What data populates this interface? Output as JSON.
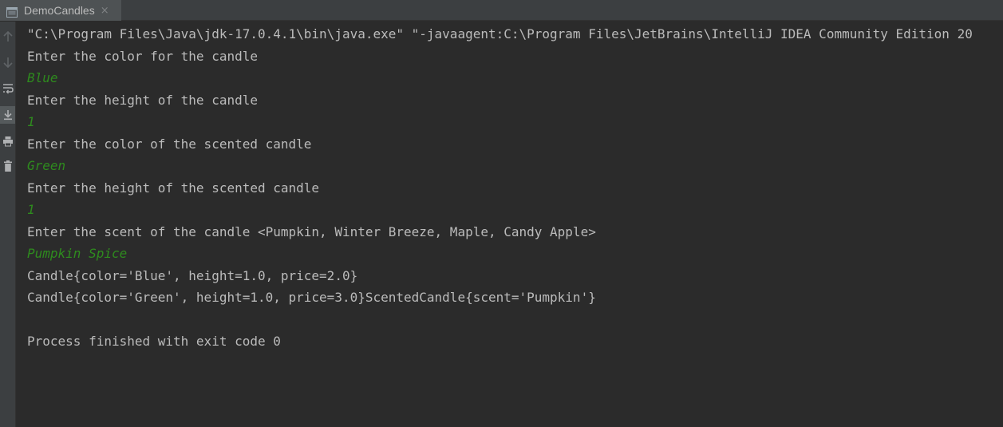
{
  "tab": {
    "title": "DemoCandles",
    "close_glyph": "×"
  },
  "toolbar": {
    "buttons": [
      {
        "name": "up-arrow-icon",
        "active": false
      },
      {
        "name": "down-arrow-icon",
        "active": false
      },
      {
        "name": "soft-wrap-icon",
        "active": false
      },
      {
        "name": "scroll-to-end-icon",
        "active": true
      },
      {
        "name": "print-icon",
        "active": false
      },
      {
        "name": "trash-icon",
        "active": false
      }
    ]
  },
  "console": {
    "lines": [
      {
        "text": "\"C:\\Program Files\\Java\\jdk-17.0.4.1\\bin\\java.exe\" \"-javaagent:C:\\Program Files\\JetBrains\\IntelliJ IDEA Community Edition 20",
        "kind": "output"
      },
      {
        "text": "Enter the color for the candle",
        "kind": "output"
      },
      {
        "text": "Blue",
        "kind": "input"
      },
      {
        "text": "Enter the height of the candle",
        "kind": "output"
      },
      {
        "text": "1",
        "kind": "input"
      },
      {
        "text": "Enter the color of the scented candle",
        "kind": "output"
      },
      {
        "text": "Green",
        "kind": "input"
      },
      {
        "text": "Enter the height of the scented candle",
        "kind": "output"
      },
      {
        "text": "1",
        "kind": "input"
      },
      {
        "text": "Enter the scent of the candle <Pumpkin, Winter Breeze, Maple, Candy Apple>",
        "kind": "output"
      },
      {
        "text": "Pumpkin Spice",
        "kind": "input"
      },
      {
        "text": "Candle{color='Blue', height=1.0, price=2.0}",
        "kind": "output"
      },
      {
        "text": "Candle{color='Green', height=1.0, price=3.0}ScentedCandle{scent='Pumpkin'}",
        "kind": "output"
      },
      {
        "text": "",
        "kind": "blank"
      },
      {
        "text": "Process finished with exit code 0",
        "kind": "output"
      }
    ]
  },
  "colors": {
    "background": "#2b2b2b",
    "output_text": "#bbbbbb",
    "input_text": "#2e8b1e"
  }
}
